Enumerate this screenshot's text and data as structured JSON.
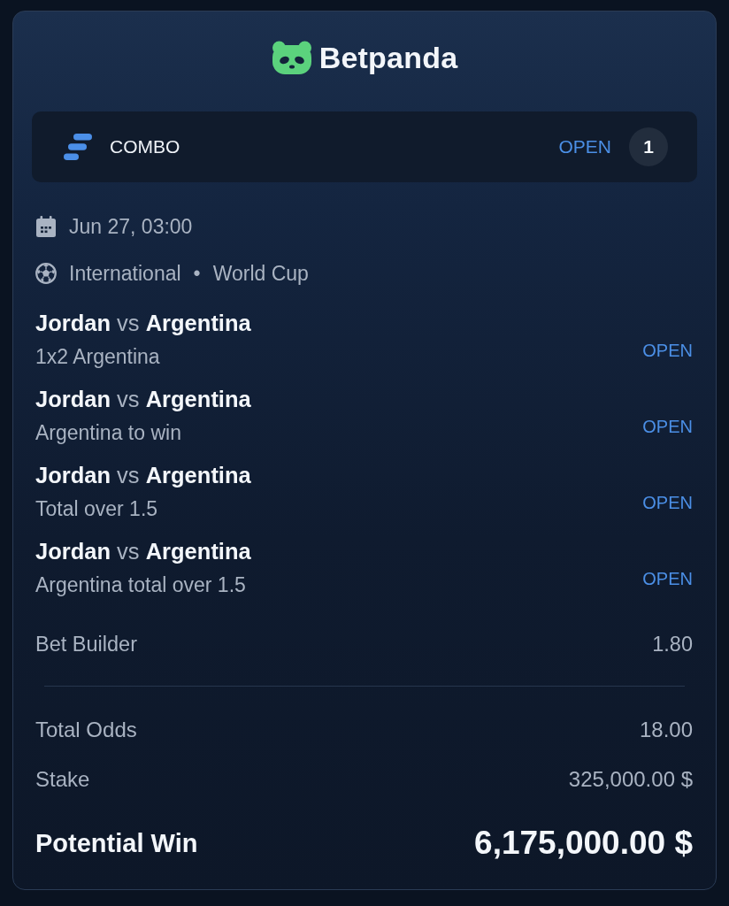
{
  "brand": {
    "name": "Betpanda"
  },
  "bet_header": {
    "type": "COMBO",
    "status": "OPEN",
    "count": "1"
  },
  "event": {
    "date": "Jun 27, 03:00",
    "category": "International",
    "separator": "•",
    "tournament": "World Cup"
  },
  "selections": [
    {
      "title": "**Jordan** vs **Argentina**",
      "market": "1x2 Argentina",
      "status": "OPEN"
    },
    {
      "title": "**Jordan** vs **Argentina**",
      "market": "Argentina to win",
      "status": "OPEN"
    },
    {
      "title": "**Jordan** vs **Argentina**",
      "market": "Total over 1.5",
      "status": "OPEN"
    },
    {
      "title": "**Jordan** vs **Argentina**",
      "market": "Argentina total over 1.5",
      "status": "OPEN"
    }
  ],
  "bet_builder": {
    "label": "Bet Builder",
    "odds": "1.80"
  },
  "summary": [
    {
      "kind": "normal",
      "label": "Total Odds",
      "value": "18.00"
    },
    {
      "kind": "normal",
      "label": "Stake",
      "value": "325,000.00 $"
    },
    {
      "kind": "highlight",
      "label": "Potential Win",
      "value": "6,175,000.00 $"
    }
  ]
}
